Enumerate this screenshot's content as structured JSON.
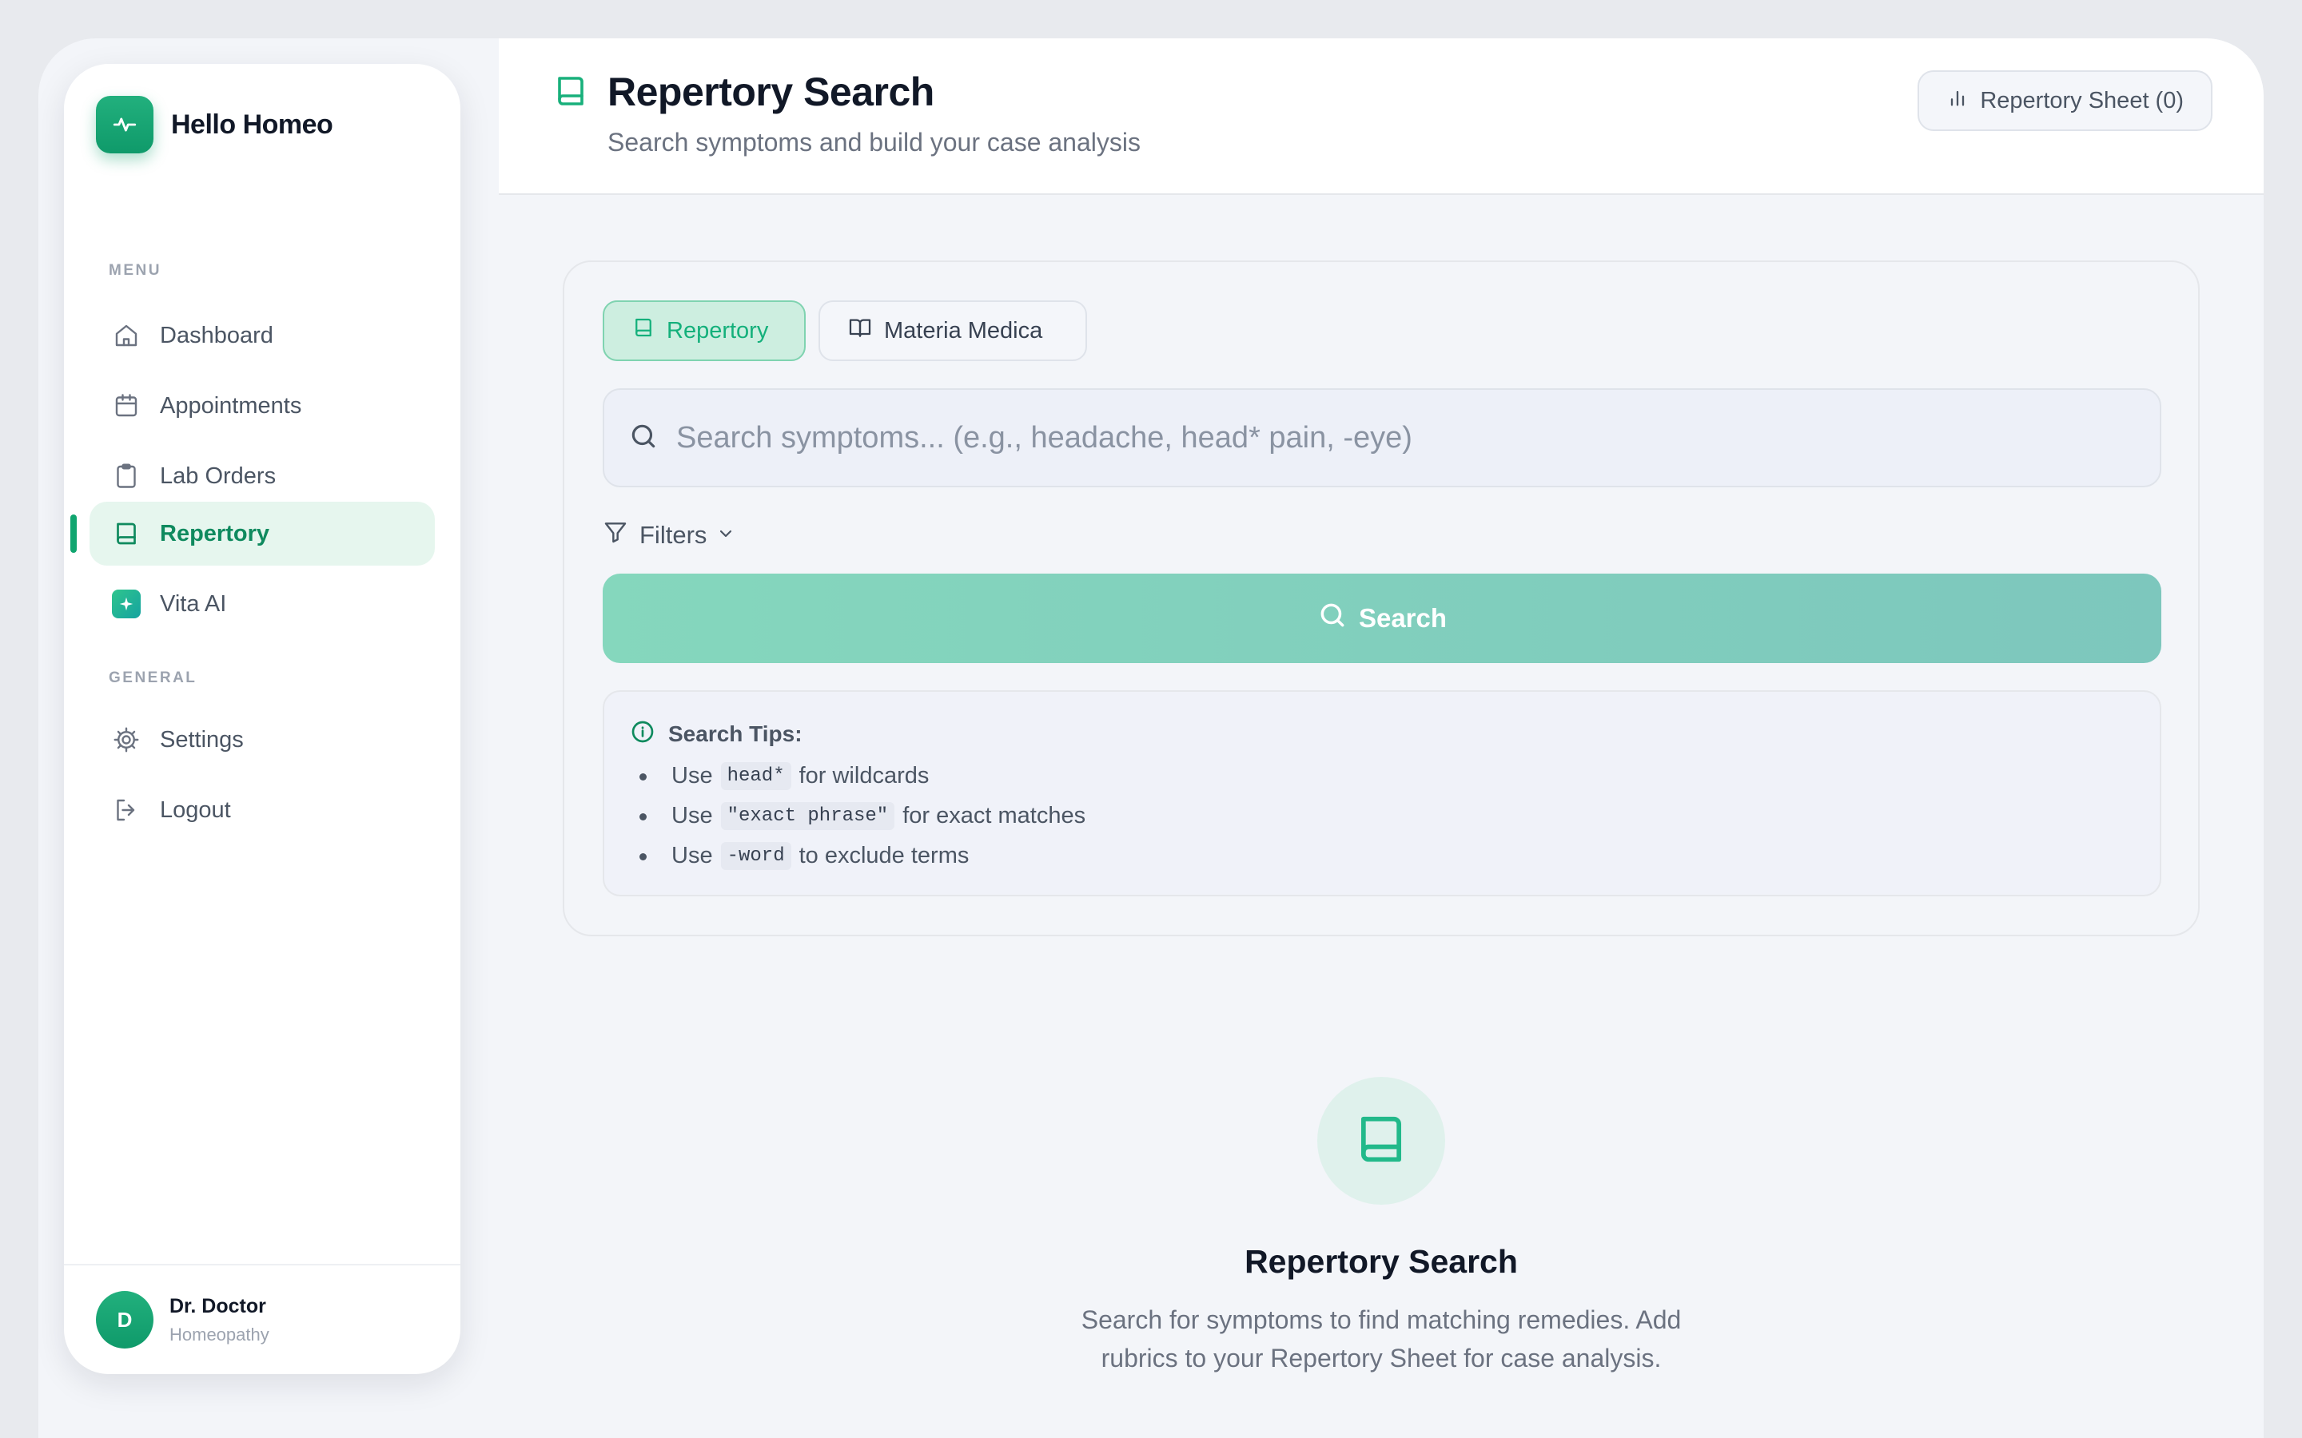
{
  "brand": {
    "name": "Hello Homeo"
  },
  "sidebar": {
    "menu_label": "MENU",
    "general_label": "GENERAL",
    "menu_items": [
      {
        "label": "Dashboard",
        "icon": "home-icon"
      },
      {
        "label": "Appointments",
        "icon": "calendar-icon"
      },
      {
        "label": "Lab Orders",
        "icon": "clipboard-icon"
      },
      {
        "label": "Repertory",
        "icon": "book-icon",
        "active": true
      },
      {
        "label": "Vita AI",
        "icon": "sparkle-icon"
      }
    ],
    "general_items": [
      {
        "label": "Settings",
        "icon": "gear-icon"
      },
      {
        "label": "Logout",
        "icon": "logout-icon"
      }
    ],
    "user": {
      "initial": "D",
      "name": "Dr. Doctor",
      "role": "Homeopathy"
    }
  },
  "header": {
    "title": "Repertory Search",
    "subtitle": "Search symptoms and build your case analysis",
    "sheet_button": "Repertory Sheet (0)"
  },
  "tabs": [
    {
      "label": "Repertory",
      "active": true
    },
    {
      "label": "Materia Medica",
      "active": false
    }
  ],
  "search": {
    "placeholder": "Search symptoms... (e.g., headache, head* pain, -eye)",
    "value": "",
    "filters_label": "Filters",
    "button_label": "Search"
  },
  "tips": {
    "title": "Search Tips:",
    "items": [
      {
        "prefix": "Use",
        "code": "head*",
        "suffix": "for wildcards"
      },
      {
        "prefix": "Use",
        "code": "\"exact phrase\"",
        "suffix": "for exact matches"
      },
      {
        "prefix": "Use",
        "code": "-word",
        "suffix": "to exclude terms"
      }
    ]
  },
  "empty_state": {
    "title": "Repertory Search",
    "description": "Search for symptoms to find matching remedies. Add rubrics to your Repertory Sheet for case analysis."
  },
  "colors": {
    "brand_green": "#10a56f",
    "active_bg": "#e6f6ee",
    "search_button": "#85d7bd"
  }
}
